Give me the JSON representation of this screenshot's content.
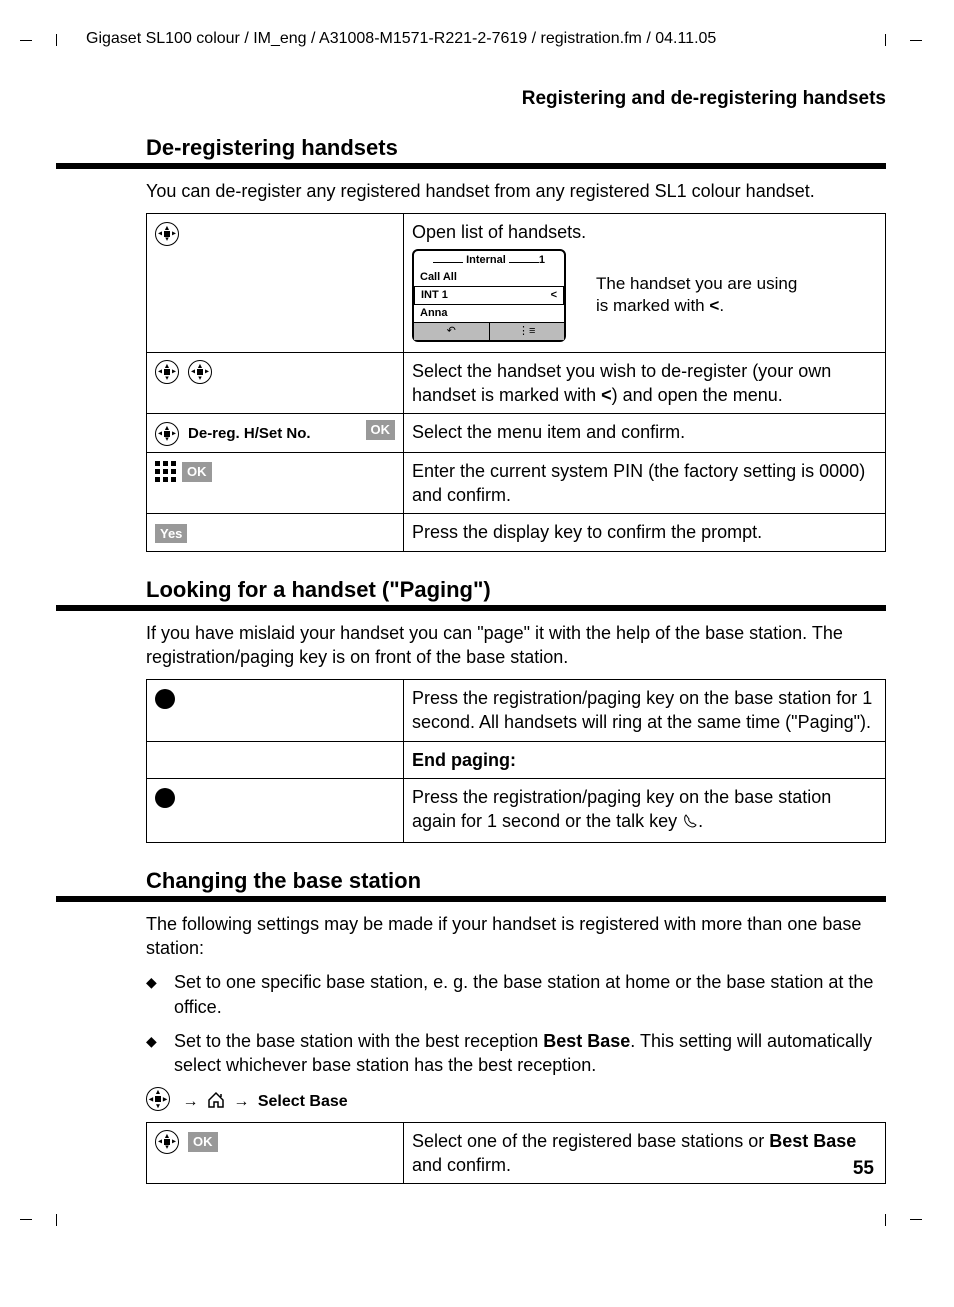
{
  "header": "Gigaset SL100 colour / IM_eng / A31008-M1571-R221-2-7619 / registration.fm / 04.11.05",
  "section_title": "Registering and de-registering handsets",
  "sec1": {
    "heading": "De-registering handsets",
    "intro": "You can de-register any registered handset from any registered SL1 colour handset.",
    "row1_right_top": "Open list of handsets.",
    "display": {
      "title_left": "Internal",
      "title_right": "1",
      "line1": "Call All",
      "line2_left": "INT 1",
      "line2_right": "<",
      "line3": "Anna",
      "soft_left": "↶",
      "soft_right": "⋮≡"
    },
    "annot1_a": "The handset you are using",
    "annot1_b_prefix": "is marked with ",
    "annot1_b_sym": "<",
    "annot1_b_suffix": ".",
    "row2_right_a": "Select the handset you wish to de-register (your own handset is marked with ",
    "row2_right_sym": "<",
    "row2_right_b": ") and open the menu.",
    "row3_left": "De-reg. H/Set No.",
    "row3_ok": "OK",
    "row3_right": "Select the menu item and confirm.",
    "row4_ok": "OK",
    "row4_right": "Enter the current system PIN (the factory setting is 0000) and confirm.",
    "row5_yes": "Yes",
    "row5_right": "Press the display key to confirm the prompt."
  },
  "sec2": {
    "heading": "Looking for a handset (\"Paging\")",
    "intro": "If you have mislaid your handset you can \"page\" it with the help of the base station. The registration/paging key is on front of the base station.",
    "row1_right": "Press the registration/paging key on the base station for 1 second. All handsets will ring at the same time (\"Paging\").",
    "row2_left": "End paging:",
    "row3_right_a": "Press the registration/paging key on the base station again for 1 second or the talk key ",
    "row3_right_b": "."
  },
  "sec3": {
    "heading": "Changing the base station",
    "intro": "The following settings may be made if your handset is registered with more than one base station:",
    "b1": "Set to one specific base station, e. g. the base station at home or the base station at the office.",
    "b2_a": "Set to the base station with the best reception ",
    "b2_bold": "Best Base",
    "b2_b": ". This setting will automatically select whichever base station has the best reception.",
    "menu_path": "Select Base",
    "row1_ok": "OK",
    "row1_right_a": "Select one of the registered base stations or ",
    "row1_right_bold": "Best Base",
    "row1_right_b": " and confirm."
  },
  "page_num": "55"
}
